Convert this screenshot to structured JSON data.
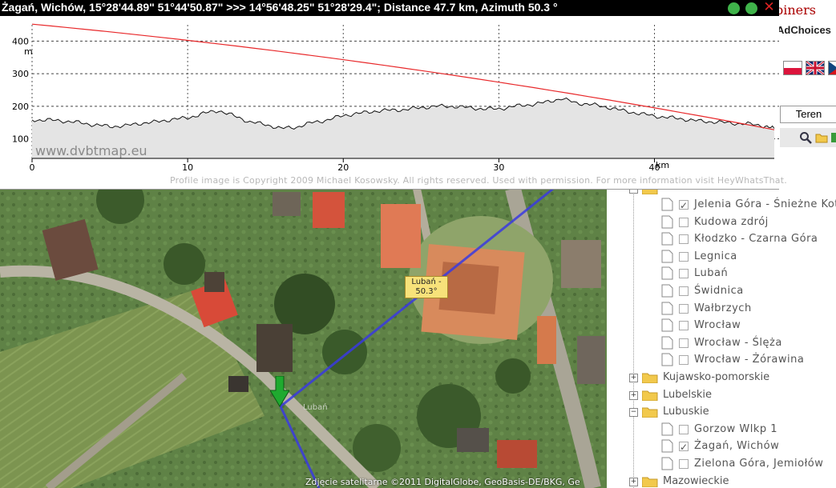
{
  "profile_window": {
    "title": "Żagań, Wichów, 15°28'44.89\" 51°44'50.87\" >>> 14°56'48.25\" 51°28'29.4\"; Distance 47.7 km, Azimuth 50.3 °",
    "watermark": "www.dvbtmap.eu",
    "copyright": "Profile image is Copyright 2009 Michael Kosowsky. All rights reserved. Used with permission. For more information visit HeyWhatsThat.",
    "buttons": {
      "minimize_icon": "green-dot",
      "maximize_icon": "green-dot",
      "close_label": "✕"
    },
    "colors": {
      "los_line": "#e8282a",
      "terrain_line": "#111111",
      "terrain_fill": "#e4e4e4",
      "titlebar": "#000000"
    }
  },
  "chart_data": {
    "type": "area",
    "title": "",
    "xlabel": "km",
    "ylabel": "m",
    "xlim": [
      0,
      47.7
    ],
    "ylim": [
      40,
      450
    ],
    "x_ticks": [
      0,
      10,
      20,
      30,
      40
    ],
    "x_tick_labels": [
      "0",
      "10",
      "20",
      "30",
      "40"
    ],
    "y_ticks": [
      100,
      200,
      300,
      400
    ],
    "y_tick_labels": [
      "100",
      "200",
      "300",
      "400"
    ],
    "grid": true,
    "legend": "none",
    "series": [
      {
        "kind": "terrain",
        "x": [
          0,
          1,
          2,
          3,
          4,
          5,
          6,
          7,
          8,
          9,
          10,
          11,
          12,
          13,
          14,
          15,
          16,
          17,
          18,
          19,
          20,
          21,
          22,
          23,
          24,
          25,
          26,
          27,
          28,
          29,
          30,
          31,
          32,
          33,
          34,
          35,
          36,
          37,
          38,
          39,
          40,
          41,
          42,
          43,
          44,
          45,
          46,
          47,
          47.7
        ],
        "y": [
          158,
          158,
          155,
          150,
          143,
          138,
          140,
          148,
          152,
          160,
          164,
          178,
          187,
          170,
          152,
          144,
          132,
          136,
          150,
          158,
          172,
          178,
          185,
          188,
          190,
          196,
          200,
          200,
          196,
          192,
          192,
          200,
          205,
          212,
          224,
          210,
          205,
          197,
          186,
          178,
          170,
          165,
          160,
          154,
          152,
          148,
          146,
          140,
          132
        ]
      },
      {
        "kind": "line_of_sight",
        "x": [
          0,
          47.7
        ],
        "y": [
          452,
          128
        ]
      }
    ]
  },
  "map": {
    "bubble_lines": [
      "Lubań -",
      "50.3°"
    ],
    "copyright": "Zdjęcie satelitarne ©2011 DigitalGlobe, GeoBasis-DE/BKG, Ge",
    "colors": {
      "azimuth_line": "#3a3ae0",
      "bubble_bg": "#f7e27a",
      "marker": "#1faa2f"
    }
  },
  "right_panel": {
    "ad_text": "biners",
    "adchoices": "AdChoices",
    "flags": [
      "flag-pl",
      "flag-gb",
      "flag-cz"
    ],
    "terrain_button": "Teren",
    "toolbar": [
      "search-icon",
      "folder-icon",
      "layers-icon"
    ],
    "tree": [
      {
        "type": "category",
        "state": "open",
        "label": ""
      },
      {
        "type": "transmitter",
        "checked": true,
        "label": "Jelenia Góra - Śnieżne Kotły"
      },
      {
        "type": "transmitter",
        "checked": false,
        "label": "Kudowa zdrój"
      },
      {
        "type": "transmitter",
        "checked": false,
        "label": "Kłodzko - Czarna Góra"
      },
      {
        "type": "transmitter",
        "checked": false,
        "label": "Legnica"
      },
      {
        "type": "transmitter",
        "checked": false,
        "label": "Lubań"
      },
      {
        "type": "transmitter",
        "checked": false,
        "label": "Świdnica"
      },
      {
        "type": "transmitter",
        "checked": false,
        "label": "Wałbrzych"
      },
      {
        "type": "transmitter",
        "checked": false,
        "label": "Wrocław"
      },
      {
        "type": "transmitter",
        "checked": false,
        "label": "Wrocław - Ślęża"
      },
      {
        "type": "transmitter",
        "checked": false,
        "label": "Wrocław - Żórawina"
      },
      {
        "type": "category",
        "state": "closed",
        "label": "Kujawsko-pomorskie"
      },
      {
        "type": "category",
        "state": "closed",
        "label": "Lubelskie"
      },
      {
        "type": "category",
        "state": "open",
        "label": "Lubuskie"
      },
      {
        "type": "transmitter",
        "checked": false,
        "label": "Gorzow Wlkp 1"
      },
      {
        "type": "transmitter",
        "checked": true,
        "label": "Żagań, Wichów"
      },
      {
        "type": "transmitter",
        "checked": false,
        "label": "Zielona Góra, Jemiołów"
      },
      {
        "type": "category",
        "state": "closed",
        "label": "Mazowieckie"
      }
    ]
  }
}
